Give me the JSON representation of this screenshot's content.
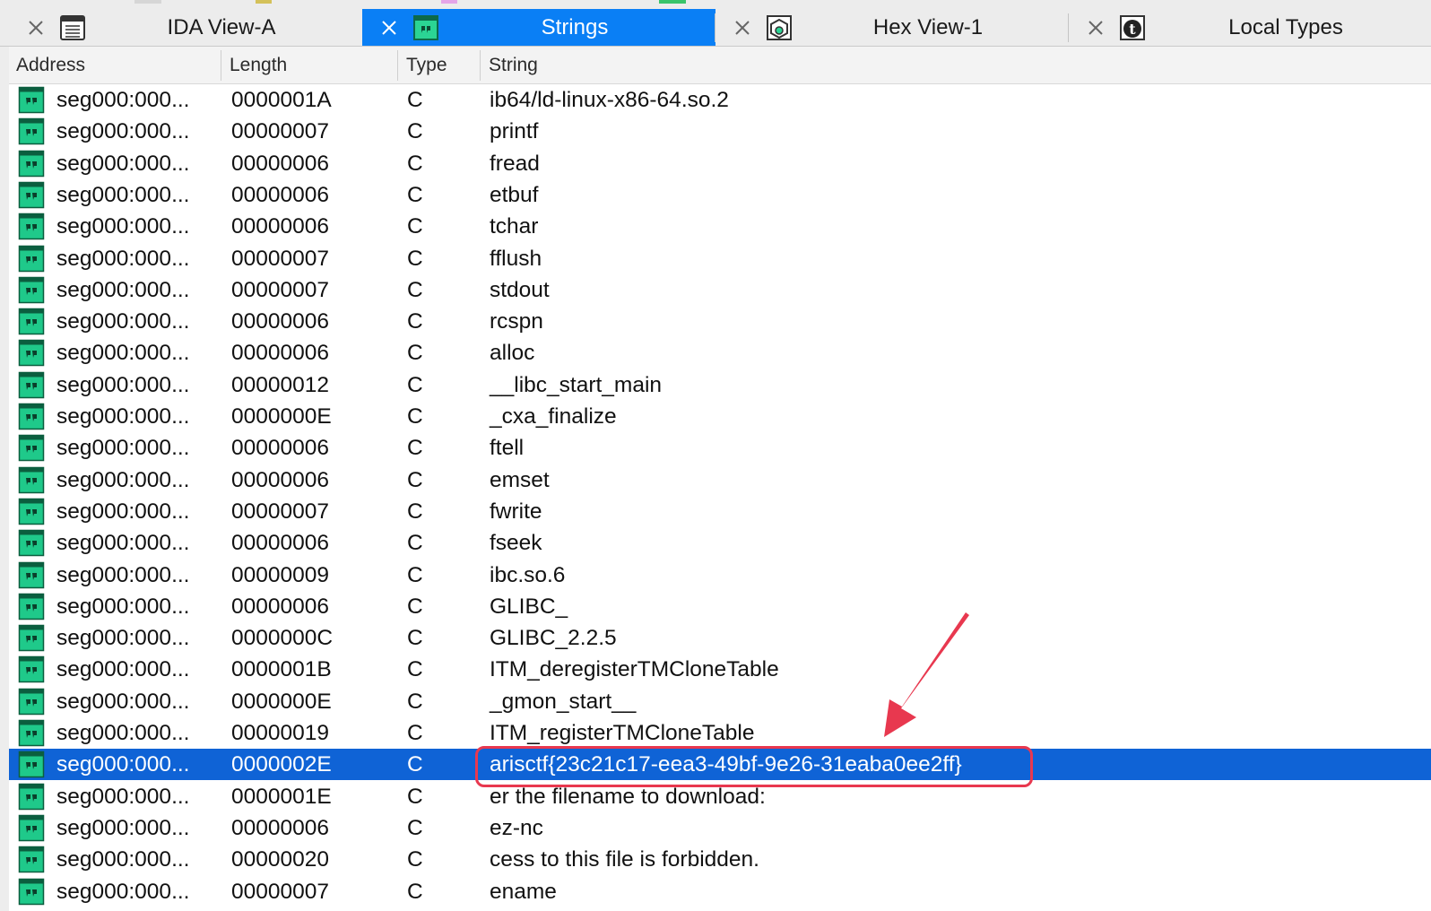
{
  "tabs": [
    {
      "label": "IDA View-A",
      "icon": "list-view-icon",
      "active": false
    },
    {
      "label": "Strings",
      "icon": "strings-icon",
      "active": true
    },
    {
      "label": "Hex View-1",
      "icon": "hex-view-icon",
      "active": false
    },
    {
      "label": "Local Types",
      "icon": "info-icon",
      "active": false
    }
  ],
  "columns": {
    "address": "Address",
    "length": "Length",
    "type": "Type",
    "string": "String"
  },
  "rows": [
    {
      "address": "seg000:000...",
      "length": "0000001A",
      "type": "C",
      "string": "ib64/ld-linux-x86-64.so.2"
    },
    {
      "address": "seg000:000...",
      "length": "00000007",
      "type": "C",
      "string": "printf"
    },
    {
      "address": "seg000:000...",
      "length": "00000006",
      "type": "C",
      "string": "fread"
    },
    {
      "address": "seg000:000...",
      "length": "00000006",
      "type": "C",
      "string": "etbuf"
    },
    {
      "address": "seg000:000...",
      "length": "00000006",
      "type": "C",
      "string": "tchar"
    },
    {
      "address": "seg000:000...",
      "length": "00000007",
      "type": "C",
      "string": "fflush"
    },
    {
      "address": "seg000:000...",
      "length": "00000007",
      "type": "C",
      "string": "stdout"
    },
    {
      "address": "seg000:000...",
      "length": "00000006",
      "type": "C",
      "string": "rcspn"
    },
    {
      "address": "seg000:000...",
      "length": "00000006",
      "type": "C",
      "string": "alloc"
    },
    {
      "address": "seg000:000...",
      "length": "00000012",
      "type": "C",
      "string": "__libc_start_main"
    },
    {
      "address": "seg000:000...",
      "length": "0000000E",
      "type": "C",
      "string": "_cxa_finalize"
    },
    {
      "address": "seg000:000...",
      "length": "00000006",
      "type": "C",
      "string": "ftell"
    },
    {
      "address": "seg000:000...",
      "length": "00000006",
      "type": "C",
      "string": "emset"
    },
    {
      "address": "seg000:000...",
      "length": "00000007",
      "type": "C",
      "string": "fwrite"
    },
    {
      "address": "seg000:000...",
      "length": "00000006",
      "type": "C",
      "string": "fseek"
    },
    {
      "address": "seg000:000...",
      "length": "00000009",
      "type": "C",
      "string": "ibc.so.6"
    },
    {
      "address": "seg000:000...",
      "length": "00000006",
      "type": "C",
      "string": "GLIBC_"
    },
    {
      "address": "seg000:000...",
      "length": "0000000C",
      "type": "C",
      "string": "GLIBC_2.2.5"
    },
    {
      "address": "seg000:000...",
      "length": "0000001B",
      "type": "C",
      "string": "ITM_deregisterTMCloneTable"
    },
    {
      "address": "seg000:000...",
      "length": "0000000E",
      "type": "C",
      "string": "_gmon_start__"
    },
    {
      "address": "seg000:000...",
      "length": "00000019",
      "type": "C",
      "string": "ITM_registerTMCloneTable"
    },
    {
      "address": "seg000:000...",
      "length": "0000002E",
      "type": "C",
      "string": "arisctf{23c21c17-eea3-49bf-9e26-31eaba0ee2ff}",
      "selected": true
    },
    {
      "address": "seg000:000...",
      "length": "0000001E",
      "type": "C",
      "string": "er the filename to download:"
    },
    {
      "address": "seg000:000...",
      "length": "00000006",
      "type": "C",
      "string": "ez-nc"
    },
    {
      "address": "seg000:000...",
      "length": "00000020",
      "type": "C",
      "string": "cess to this file is forbidden."
    },
    {
      "address": "seg000:000...",
      "length": "00000007",
      "type": "C",
      "string": "ename"
    }
  ],
  "colors": {
    "active_tab": "#0a7ff5",
    "selected_row": "#0f63d6",
    "annotation": "#e8384f",
    "string_icon": "#1fc98a"
  }
}
